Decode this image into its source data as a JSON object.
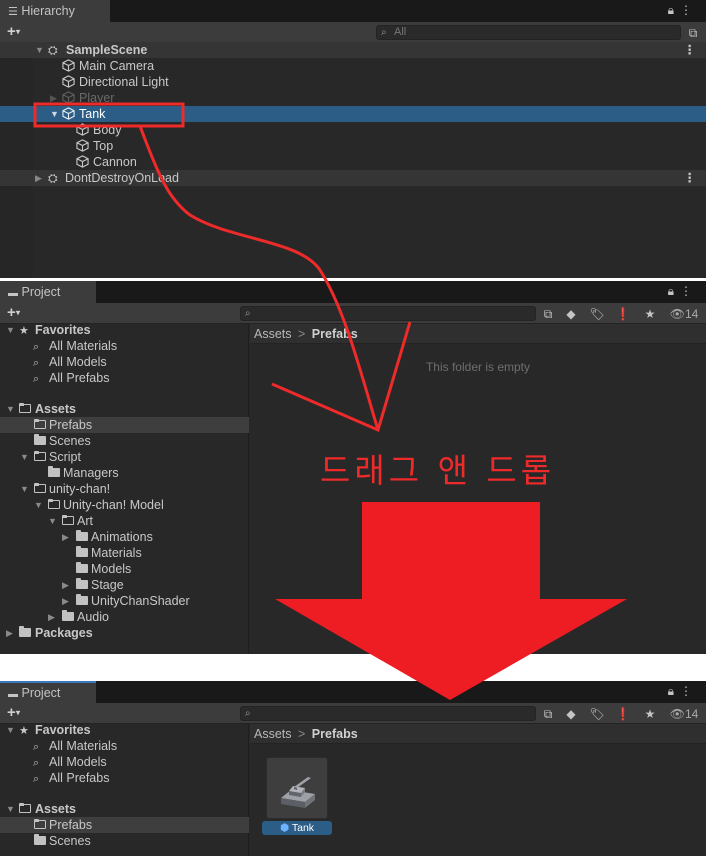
{
  "hierarchy": {
    "tab_label": "Hierarchy",
    "search_placeholder": "All",
    "scene": "SampleScene",
    "items": [
      "Main Camera",
      "Directional Light",
      "Player",
      "Tank",
      "Body",
      "Top",
      "Cannon"
    ],
    "dont_destroy": "DontDestroyOnLoad"
  },
  "project": {
    "tab_label": "Project",
    "hidden_count": "14",
    "favorites": {
      "label": "Favorites",
      "items": [
        "All Materials",
        "All Models",
        "All Prefabs"
      ]
    },
    "assets": {
      "label": "Assets",
      "prefabs": "Prefabs",
      "scenes": "Scenes",
      "script": "Script",
      "managers": "Managers",
      "unitychan": "unity-chan!",
      "unitychan_model": "Unity-chan! Model",
      "art": "Art",
      "animations": "Animations",
      "materials": "Materials",
      "models": "Models",
      "stage": "Stage",
      "shader": "UnityChanShader",
      "audio": "Audio"
    },
    "packages": "Packages",
    "breadcrumb": {
      "root": "Assets",
      "sep": ">",
      "current": "Prefabs"
    },
    "empty_message": "This folder is empty",
    "prefab_asset": "Tank"
  },
  "annotation": {
    "text": "드래그 앤 드롭",
    "color": "#ee2a2a"
  }
}
